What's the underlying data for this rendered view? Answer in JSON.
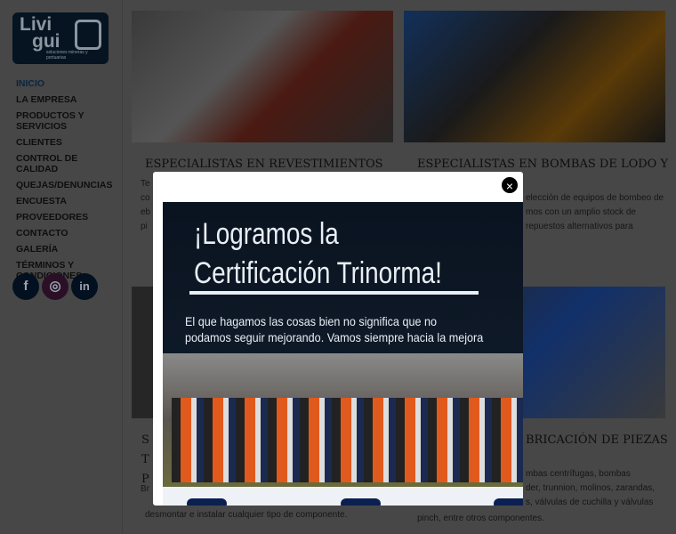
{
  "logo": {
    "text1": "Livi",
    "text2": "gui",
    "tagline": "soluciones mineras y portuarias"
  },
  "nav": [
    "INICIO",
    "LA EMPRESA",
    "PRODUCTOS Y SERVICIOS",
    "CLIENTES",
    "CONTROL DE CALIDAD",
    "QUEJAS/DENUNCIAS",
    "ENCUESTA",
    "PROVEEDORES",
    "CONTACTO",
    "GALERÍA",
    "TÉRMINOS Y CONDICIONES"
  ],
  "social": [
    {
      "icon": "facebook-icon",
      "glyph": "f",
      "color": "#0b2a55"
    },
    {
      "icon": "instagram-icon",
      "glyph": "◎",
      "color": "#5a2050"
    },
    {
      "icon": "linkedin-icon",
      "glyph": "in",
      "color": "#0b2a55"
    }
  ],
  "cards": [
    {
      "title": "ESPECIALISTAS EN REVESTIMIENTOS",
      "lines": [
        "Te",
        "co",
        "eb",
        "pi"
      ]
    },
    {
      "title": "ESPECIALISTAS EN BOMBAS DE LODO Y",
      "lines": [
        "elección de equipos de bombeo de",
        "mos con un amplio stock de",
        "repuestos alternativos para"
      ]
    },
    {
      "title": "S",
      "title2": "T",
      "title3": "P",
      "lines": [
        "Br",
        "desmontar e instalar cualquier tipo de componente."
      ]
    },
    {
      "title": "BRICACIÓN DE PIEZAS",
      "lines": [
        "mbas centrífugas, bombas",
        "der, trunnion, molinos, zarandas,",
        "s, válvulas de cuchilla y válvulas",
        "pinch, entre otros componentes."
      ]
    }
  ],
  "modal": {
    "close": "×",
    "title1": "¡Logramos la",
    "title2": "Certificación Trinorma!",
    "sub1": "El que hagamos las cosas bien no significa que no",
    "sub2": "podamos seguir mejorando. Vamos siempre hacia la mejora"
  }
}
